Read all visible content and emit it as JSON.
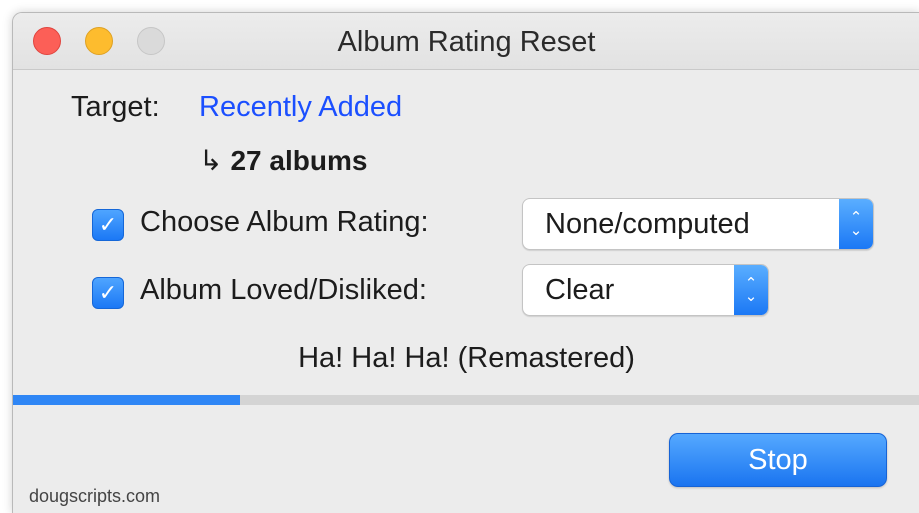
{
  "window": {
    "title": "Album Rating Reset"
  },
  "target": {
    "label": "Target:",
    "value": "Recently Added",
    "arrow": "↳",
    "count": "27 albums"
  },
  "options": [
    {
      "label": "Choose Album Rating:",
      "checked": true,
      "select_value": "None/computed"
    },
    {
      "label": "Album Loved/Disliked:",
      "checked": true,
      "select_value": "Clear"
    }
  ],
  "status_text": "Ha! Ha! Ha! (Remastered)",
  "progress": {
    "percent": 25
  },
  "stop_label": "Stop",
  "footer": "dougscripts.com",
  "colors": {
    "link": "#1b4fff",
    "accent": "#2f86f5"
  },
  "icons": {
    "checkbox": "checkmark-icon",
    "stepper": "up-down-chevron-icon",
    "count_arrow": "return-arrow-icon"
  }
}
